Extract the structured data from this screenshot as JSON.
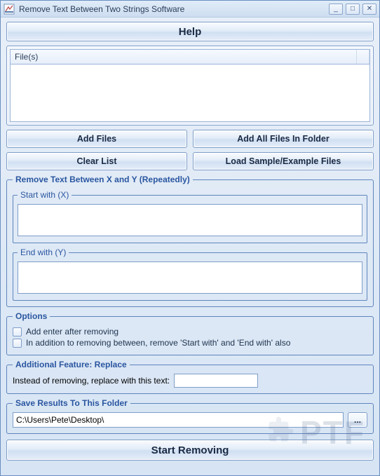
{
  "window": {
    "title": "Remove Text Between Two Strings Software",
    "min": "_",
    "max": "□",
    "close": "✕"
  },
  "help_label": "Help",
  "files": {
    "col_label": "File(s)"
  },
  "buttons": {
    "add_files": "Add Files",
    "add_folder": "Add All Files In Folder",
    "clear": "Clear List",
    "load_sample": "Load Sample/Example Files",
    "start": "Start Removing",
    "browse": "..."
  },
  "remove_group": {
    "legend": "Remove Text Between X and Y (Repeatedly)",
    "start_legend": "Start with (X)",
    "end_legend": "End with (Y)",
    "start_value": "",
    "end_value": ""
  },
  "options_group": {
    "legend": "Options",
    "opt1": "Add enter after removing",
    "opt2": "In addition to removing between, remove 'Start with' and 'End with' also"
  },
  "replace_group": {
    "legend": "Additional Feature: Replace",
    "label": "Instead of removing, replace with this text:",
    "value": ""
  },
  "save_group": {
    "legend": "Save Results To This Folder",
    "path": "C:\\Users\\Pete\\Desktop\\"
  },
  "watermark": "PTF"
}
